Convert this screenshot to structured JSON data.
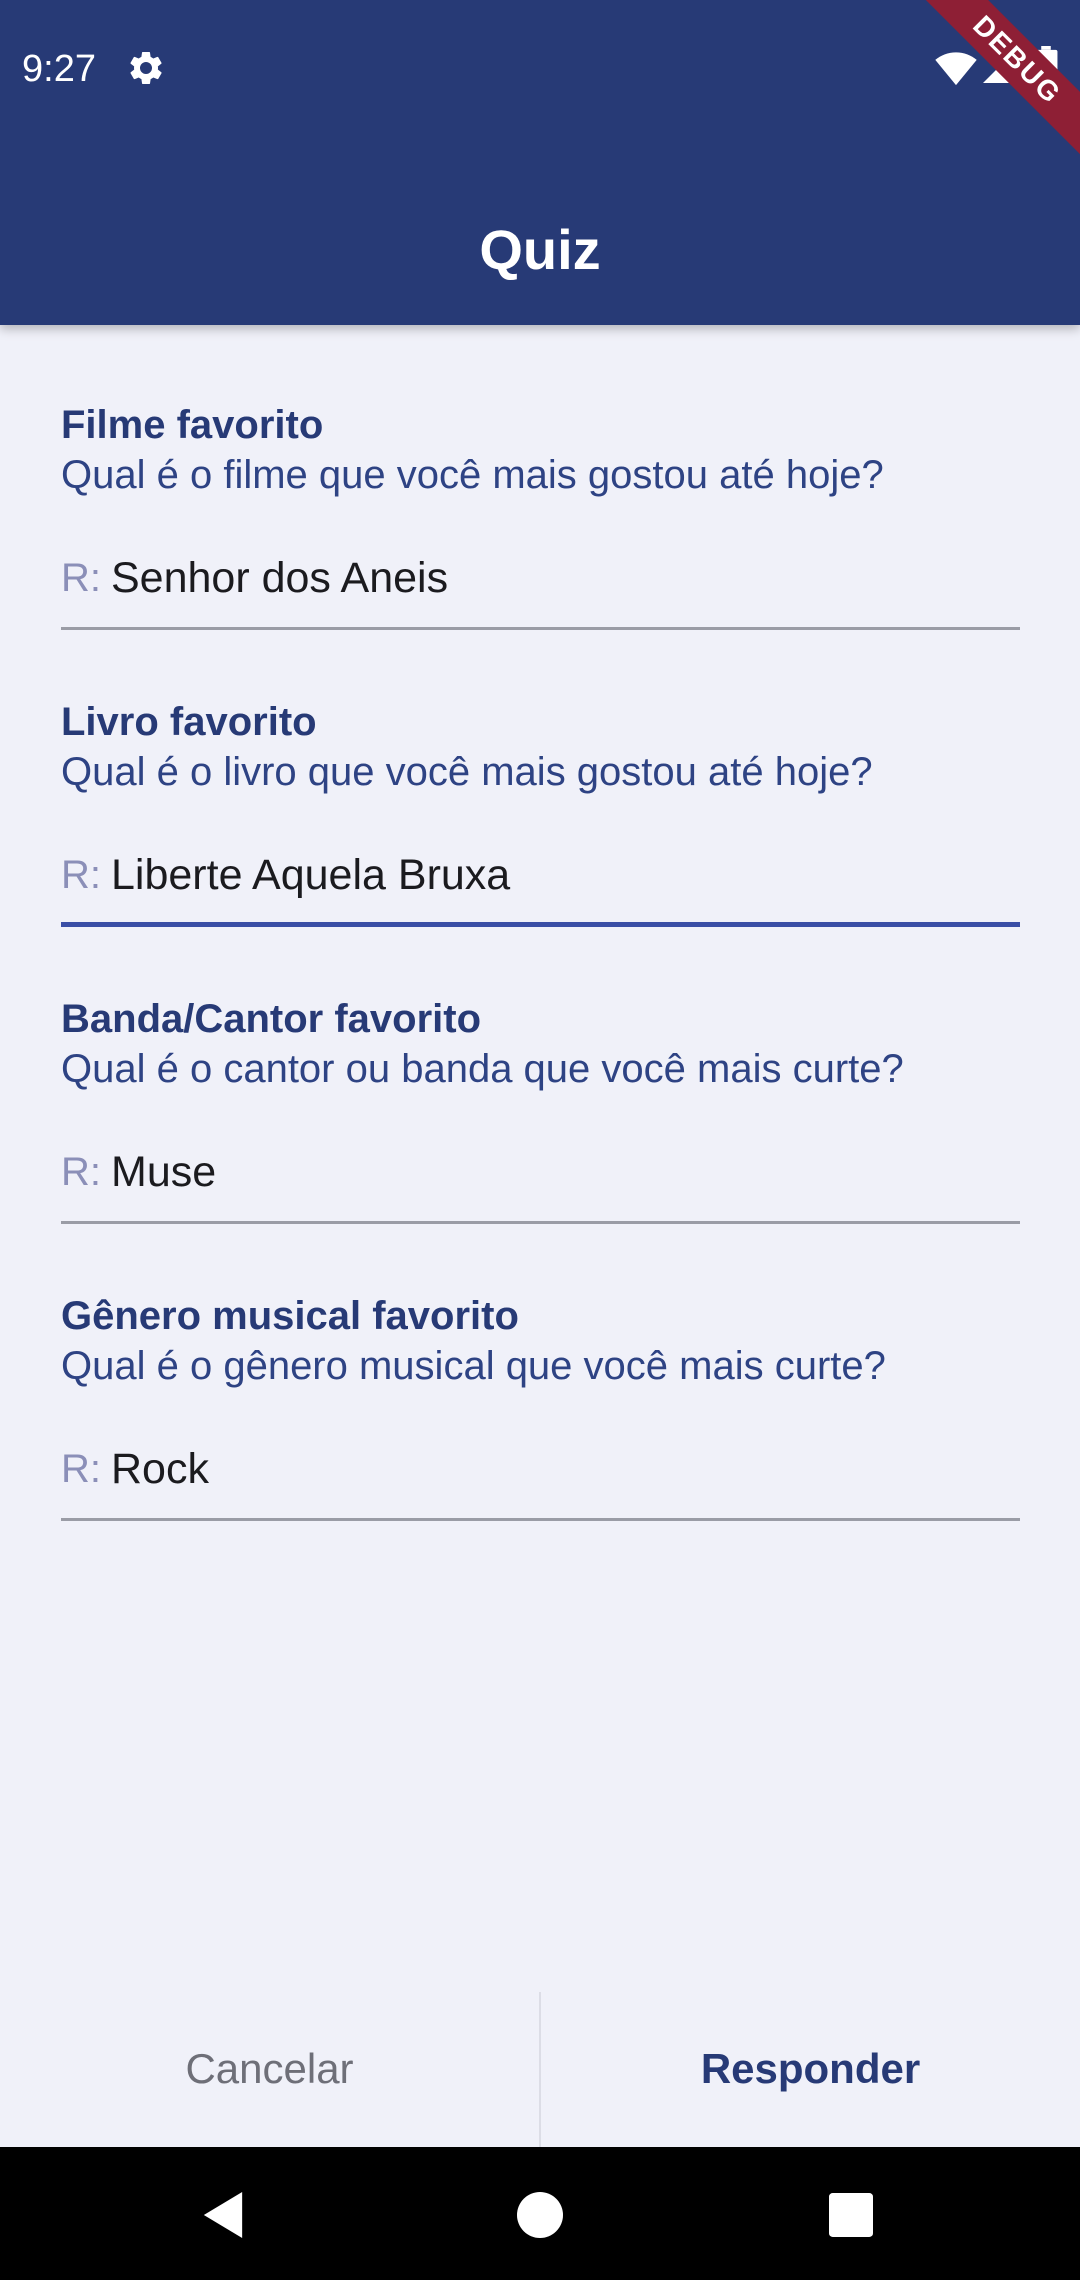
{
  "status_bar": {
    "time": "9:27"
  },
  "debug_banner": "DEBUG",
  "app_bar": {
    "title": "Quiz"
  },
  "questions": [
    {
      "title": "Filme favorito",
      "question": "Qual é o filme que você mais gostou até hoje?",
      "answer_prefix": "R:",
      "answer": "Senhor dos Aneis",
      "focused": false
    },
    {
      "title": "Livro favorito",
      "question": "Qual é o livro que você mais gostou até hoje?",
      "answer_prefix": "R:",
      "answer": "Liberte Aquela Bruxa",
      "focused": true
    },
    {
      "title": "Banda/Cantor favorito",
      "question": "Qual é o cantor ou banda que você mais curte?",
      "answer_prefix": "R:",
      "answer": "Muse",
      "focused": false
    },
    {
      "title": "Gênero musical favorito",
      "question": "Qual é o gênero musical que você mais curte?",
      "answer_prefix": "R:",
      "answer": "Rock",
      "focused": false
    }
  ],
  "actions": {
    "cancel_label": "Cancelar",
    "submit_label": "Responder"
  },
  "colors": {
    "app_bar": "#273a76",
    "background": "#f0f1f9",
    "focused_underline": "#3a4ea6",
    "debug_ribbon": "#8e1f35"
  },
  "icons": {
    "status": [
      "settings-icon",
      "wifi-icon",
      "signal-icon",
      "battery-icon"
    ],
    "navigation": [
      "back-icon",
      "home-icon",
      "recents-icon"
    ]
  }
}
